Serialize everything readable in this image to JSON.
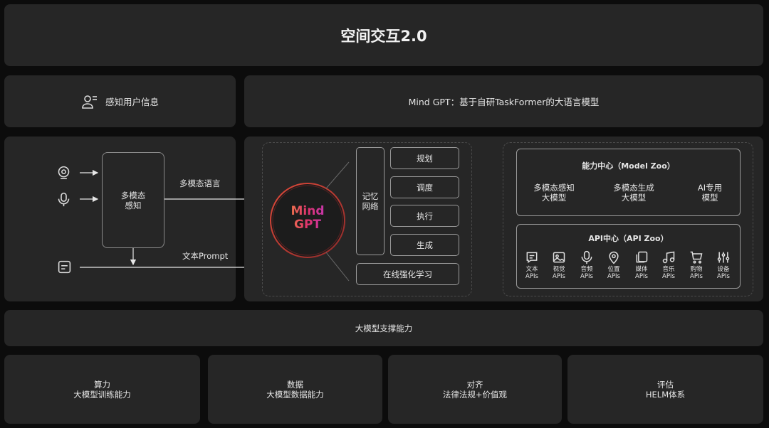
{
  "header": {
    "title": "空间交互2.0"
  },
  "row2": {
    "left_label": "感知用户信息",
    "right_label": "Mind GPT：基于自研TaskFormer的大语言模型"
  },
  "perception": {
    "multimodal_box": "多模态\n感知",
    "arrow_label_top": "多模态语言",
    "arrow_label_bottom": "文本Prompt"
  },
  "mindgpt": {
    "logo_line1": "Mind",
    "logo_line2": "GPT",
    "memory": "记忆\n网络",
    "steps": [
      "规划",
      "调度",
      "执行",
      "生成"
    ],
    "online_learning": "在线强化学习"
  },
  "capability_center": {
    "title": "能力中心（Model Zoo）",
    "items": [
      "多模态感知\n大模型",
      "多模态生成\n大模型",
      "AI专用\n模型"
    ]
  },
  "api_center": {
    "title": "API中心（API Zoo）",
    "apis": [
      {
        "icon": "text-icon",
        "label": "文本\nAPIs"
      },
      {
        "icon": "image-icon",
        "label": "视觉\nAPIs"
      },
      {
        "icon": "microphone-icon",
        "label": "音频\nAPIs"
      },
      {
        "icon": "location-pin-icon",
        "label": "位置\nAPIs"
      },
      {
        "icon": "media-icon",
        "label": "媒体\nAPIs"
      },
      {
        "icon": "music-note-icon",
        "label": "音乐\nAPIs"
      },
      {
        "icon": "shopping-cart-icon",
        "label": "购物\nAPIs"
      },
      {
        "icon": "sliders-icon",
        "label": "设备\nAPIs"
      }
    ]
  },
  "support": {
    "title": "大模型支撑能力"
  },
  "bottom": [
    {
      "title": "算力",
      "subtitle": "大模型训练能力"
    },
    {
      "title": "数据",
      "subtitle": "大模型数据能力"
    },
    {
      "title": "对齐",
      "subtitle": "法律法规+价值观"
    },
    {
      "title": "评估",
      "subtitle": "HELM体系"
    }
  ],
  "colors": {
    "background": "#0c0c0c",
    "panel": "#262626",
    "logo_gradient": [
      "#f39c34",
      "#e0326e",
      "#b23bd6"
    ],
    "ring": "#c0392b"
  }
}
